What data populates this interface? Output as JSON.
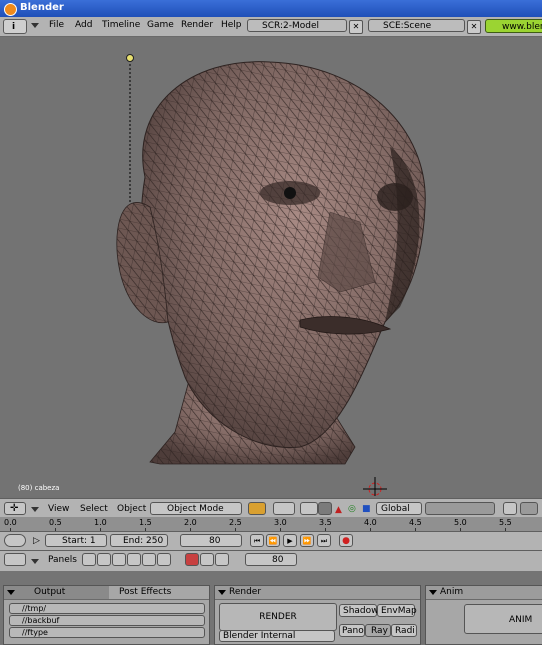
{
  "window": {
    "title": "Blender"
  },
  "menu": [
    "File",
    "Add",
    "Timeline",
    "Game",
    "Render",
    "Help"
  ],
  "screen_field": "SCR:2-Model",
  "scene_field": "SCE:Scene",
  "url": "www.blen",
  "viewport": {
    "object_label": "(80) cabeza"
  },
  "view3d_header": {
    "menus": [
      "View",
      "Select",
      "Object"
    ],
    "mode": "Object Mode",
    "orientation": "Global"
  },
  "timeline": {
    "ticks": [
      "0.0",
      "0.5",
      "1.0",
      "1.5",
      "2.0",
      "2.5",
      "3.0",
      "3.5",
      "4.0",
      "4.5",
      "5.0",
      "5.5"
    ],
    "start": "Start: 1",
    "end": "End: 250",
    "current_frame": "80",
    "frame_field": "80"
  },
  "buttons_header": {
    "panels_label": "Panels"
  },
  "output_panel": {
    "tabs": [
      "Output",
      "Post Effects"
    ],
    "paths": [
      "//tmp/",
      "//backbuf",
      "//ftype"
    ]
  },
  "render_panel": {
    "title": "Render",
    "render_button": "RENDER",
    "engine": "Blender Internal",
    "toggles": [
      "Shadow",
      "EnvMap",
      "Pano",
      "Ray",
      "Radi"
    ]
  },
  "anim_panel": {
    "title": "Anim",
    "anim_button": "ANIM"
  },
  "colors": {
    "title_bar": "#2a5fcc",
    "header": "#b3b3b3",
    "viewport": "#737373",
    "mesh": "#8a706a",
    "url_field": "#9bd432"
  }
}
